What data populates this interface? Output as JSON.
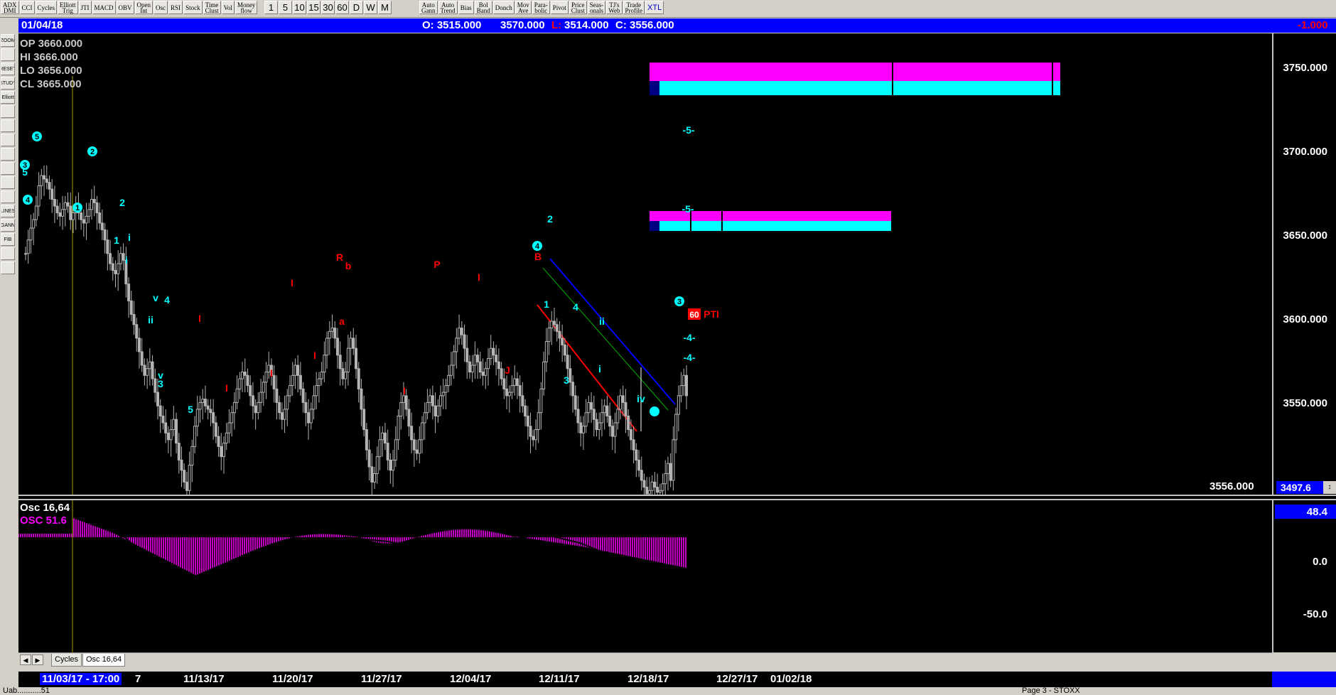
{
  "toolbar": {
    "group1": [
      "ADX\nDMI",
      "CCI",
      "Cycles",
      "Elliott\nTrig",
      "JTI",
      "MACD",
      "OBV",
      "Open\nInt",
      "Osc",
      "RSI",
      "Stock",
      "Time\nClust",
      "Vol",
      "Money\nflow"
    ],
    "group2": [
      "1",
      "5",
      "10",
      "15",
      "30",
      "60",
      "D",
      "W",
      "M"
    ],
    "group3": [
      "Auto\nGann",
      "Auto\nTrend",
      "Bias",
      "Bol\nBand",
      "Donch",
      "Mov\nAve",
      "Para-\nbolic",
      "Pivot",
      "Price\nClust",
      "Seas-\nonals",
      "TJ's\nWeb",
      "Trade\nProfile",
      "XTL"
    ]
  },
  "ohlc_bar": {
    "date": "01/04/18",
    "open": "O: 3515.000",
    "high": "3570.000",
    "low_prefix": "L:",
    "low": "3514.000",
    "close": "C: 3556.000",
    "change": "-1.000"
  },
  "ohlc_info": {
    "op": "OP  3660.000",
    "hi": "HI   3666.000",
    "lo": "LO  3656.000",
    "cl": "CL  3665.000"
  },
  "left_tools": [
    "ZOOM",
    "",
    "RESET",
    "STUDY",
    "Elliott",
    "",
    "",
    "",
    "",
    "",
    "",
    "",
    "LINES",
    "GANN",
    "FIB",
    "",
    ""
  ],
  "price_axis": {
    "labels": [
      "3750.000",
      "3700.000",
      "3650.000",
      "3600.000",
      "3550.000"
    ],
    "current": "3556.000",
    "lower": "3497.6"
  },
  "osc_panel": {
    "label1": "Osc 16,64",
    "label2": "OSC 51.6",
    "axis": [
      "0.0",
      "-50.0"
    ],
    "value_box": "48.4"
  },
  "tabs": [
    "Cycles",
    "Osc 16,64"
  ],
  "dates": {
    "first": "11/03/17 - 17:00",
    "first_suffix": "7",
    "labels": [
      "11/13/17",
      "11/20/17",
      "11/27/17",
      "12/04/17",
      "12/11/17",
      "12/18/17",
      "12/27/17",
      "01/02/18"
    ]
  },
  "annotations": {
    "pti_value": "60",
    "pti_text": "PTI",
    "wave_cyan": [
      "5",
      "3",
      "5",
      "4",
      "2",
      "1",
      "2",
      "1",
      "i",
      "i",
      "v",
      "4",
      "ii",
      "v",
      "3",
      "5",
      "2",
      "1",
      "4",
      "3",
      "i",
      "ii",
      "iv",
      "4",
      "3",
      "-5-",
      "-5-",
      "-4-",
      "-4-"
    ],
    "wave_red": [
      "R",
      "b",
      "a",
      "I",
      "I",
      "I",
      "I",
      "I",
      "P",
      "I",
      "I",
      "J",
      "B"
    ]
  },
  "status": {
    "left": "Uab...........51",
    "right": "Page 3 - STOXX"
  },
  "colors": {
    "bull_bear": "#b4b4b4",
    "magenta": "#ff00ff",
    "cyan": "#00ffff",
    "navy": "#000080",
    "blue": "#0000ff",
    "red": "#ff0000",
    "green": "#00b000",
    "olive": "#a0a000"
  },
  "chart_data": {
    "type": "candlestick",
    "price_range": [
      3497.6,
      3770
    ],
    "candle_closes": [
      3640,
      3648,
      3655,
      3660,
      3668,
      3680,
      3686,
      3684,
      3682,
      3678,
      3672,
      3668,
      3664,
      3662,
      3666,
      3670,
      3668,
      3660,
      3664,
      3668,
      3664,
      3660,
      3658,
      3662,
      3666,
      3672,
      3670,
      3664,
      3658,
      3654,
      3648,
      3640,
      3634,
      3630,
      3628,
      3634,
      3640,
      3636,
      3622,
      3612,
      3604,
      3598,
      3590,
      3582,
      3574,
      3568,
      3572,
      3576,
      3566,
      3558,
      3550,
      3544,
      3540,
      3534,
      3530,
      3536,
      3542,
      3528,
      3518,
      3512,
      3505,
      3500,
      3515,
      3526,
      3538,
      3548,
      3552,
      3554,
      3550,
      3548,
      3546,
      3540,
      3532,
      3526,
      3520,
      3528,
      3534,
      3540,
      3546,
      3552,
      3560,
      3566,
      3570,
      3568,
      3562,
      3556,
      3550,
      3546,
      3552,
      3558,
      3564,
      3570,
      3574,
      3568,
      3560,
      3552,
      3546,
      3542,
      3548,
      3556,
      3562,
      3568,
      3574,
      3568,
      3560,
      3552,
      3546,
      3540,
      3548,
      3556,
      3562,
      3566,
      3570,
      3580,
      3590,
      3594,
      3596,
      3590,
      3580,
      3572,
      3566,
      3570,
      3584,
      3590,
      3584,
      3572,
      3560,
      3548,
      3536,
      3524,
      3514,
      3505,
      3510,
      3520,
      3530,
      3534,
      3528,
      3518,
      3512,
      3518,
      3530,
      3544,
      3552,
      3556,
      3548,
      3538,
      3530,
      3524,
      3522,
      3530,
      3540,
      3546,
      3552,
      3556,
      3550,
      3544,
      3550,
      3556,
      3558,
      3562,
      3568,
      3574,
      3582,
      3590,
      3596,
      3592,
      3584,
      3576,
      3570,
      3574,
      3580,
      3576,
      3570,
      3568,
      3572,
      3578,
      3584,
      3580,
      3576,
      3572,
      3566,
      3560,
      3556,
      3558,
      3562,
      3566,
      3562,
      3556,
      3550,
      3544,
      3538,
      3532,
      3530,
      3536,
      3546,
      3560,
      3576,
      3588,
      3596,
      3600,
      3598,
      3594,
      3590,
      3586,
      3580,
      3572,
      3564,
      3556,
      3548,
      3540,
      3534,
      3538,
      3546,
      3552,
      3548,
      3542,
      3536,
      3540,
      3546,
      3550,
      3544,
      3538,
      3532,
      3540,
      3548,
      3556,
      3552,
      3544,
      3536,
      3530,
      3524,
      3518,
      3512,
      3506,
      3502,
      3498,
      3500,
      3505,
      3502,
      3499,
      3500,
      3504,
      3510,
      3516,
      3506,
      3530,
      3545,
      3556,
      3562,
      3568,
      3556
    ]
  }
}
